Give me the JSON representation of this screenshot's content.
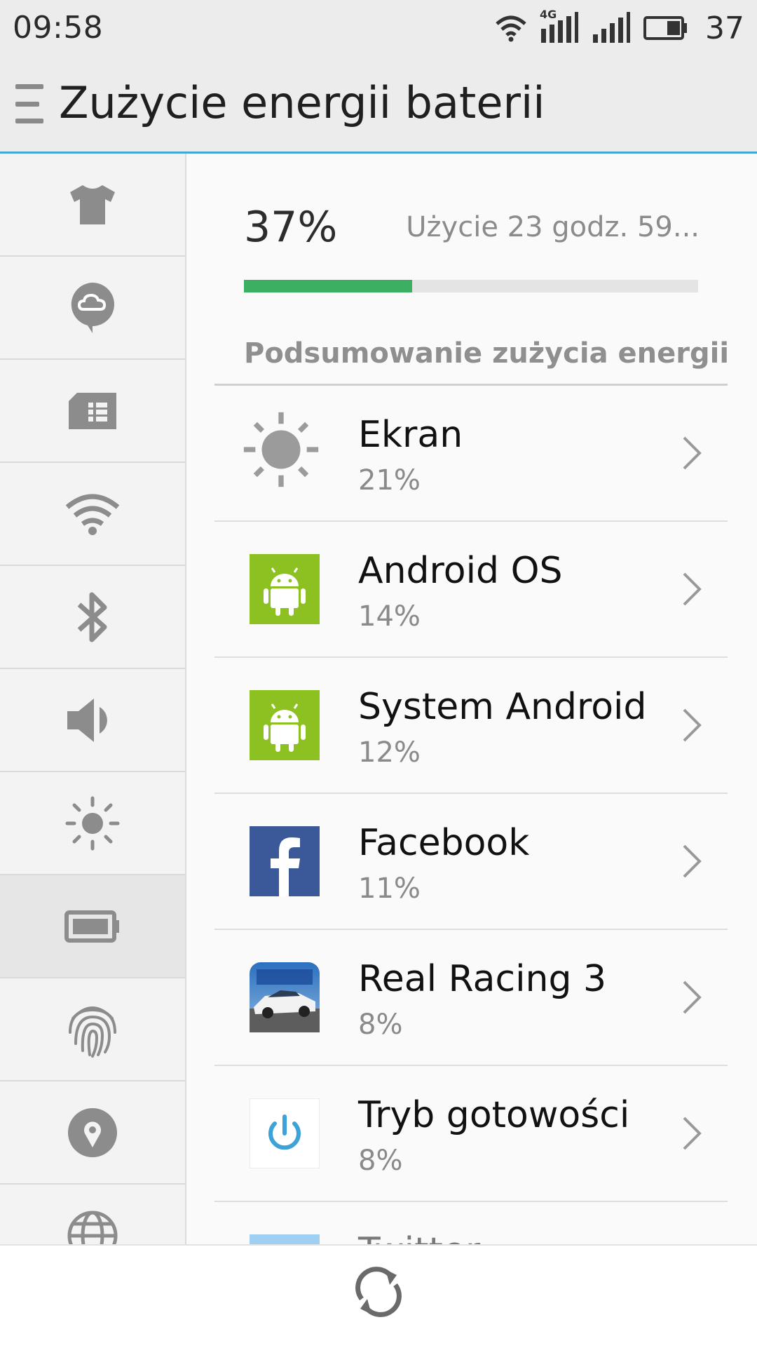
{
  "status_bar": {
    "time": "09:58",
    "battery_level": "37",
    "network_label": "4G"
  },
  "header": {
    "title": "Zużycie energii baterii"
  },
  "sidebar": {
    "items": [
      {
        "icon": "tshirt-icon"
      },
      {
        "icon": "cloud-pin-icon"
      },
      {
        "icon": "sim-card-icon"
      },
      {
        "icon": "wifi-icon"
      },
      {
        "icon": "bluetooth-icon"
      },
      {
        "icon": "speaker-icon"
      },
      {
        "icon": "brightness-icon"
      },
      {
        "icon": "battery-icon",
        "active": true
      },
      {
        "icon": "fingerprint-icon"
      },
      {
        "icon": "location-icon"
      },
      {
        "icon": "globe-icon"
      },
      {
        "icon": "grid-icon"
      }
    ]
  },
  "battery": {
    "percent_label": "37%",
    "percent_value": 37,
    "usage_text": "Użycie 23 godz. 59...",
    "bar_color": "#3daf62"
  },
  "summary": {
    "section_title": "Podsumowanie zużycia energii",
    "items": [
      {
        "name": "Ekran",
        "value": "21%",
        "icon": "sun-icon"
      },
      {
        "name": "Android OS",
        "value": "14%",
        "icon": "android-icon"
      },
      {
        "name": "System Android",
        "value": "12%",
        "icon": "android-icon"
      },
      {
        "name": "Facebook",
        "value": "11%",
        "icon": "facebook-icon"
      },
      {
        "name": "Real Racing 3",
        "value": "8%",
        "icon": "real-racing-icon"
      },
      {
        "name": "Tryb gotowości",
        "value": "8%",
        "icon": "power-icon"
      },
      {
        "name": "Twitter",
        "value": "",
        "icon": "twitter-icon"
      }
    ]
  },
  "colors": {
    "accent": "#45a6d6",
    "android_green": "#8cc121",
    "facebook_blue": "#3b5998"
  }
}
